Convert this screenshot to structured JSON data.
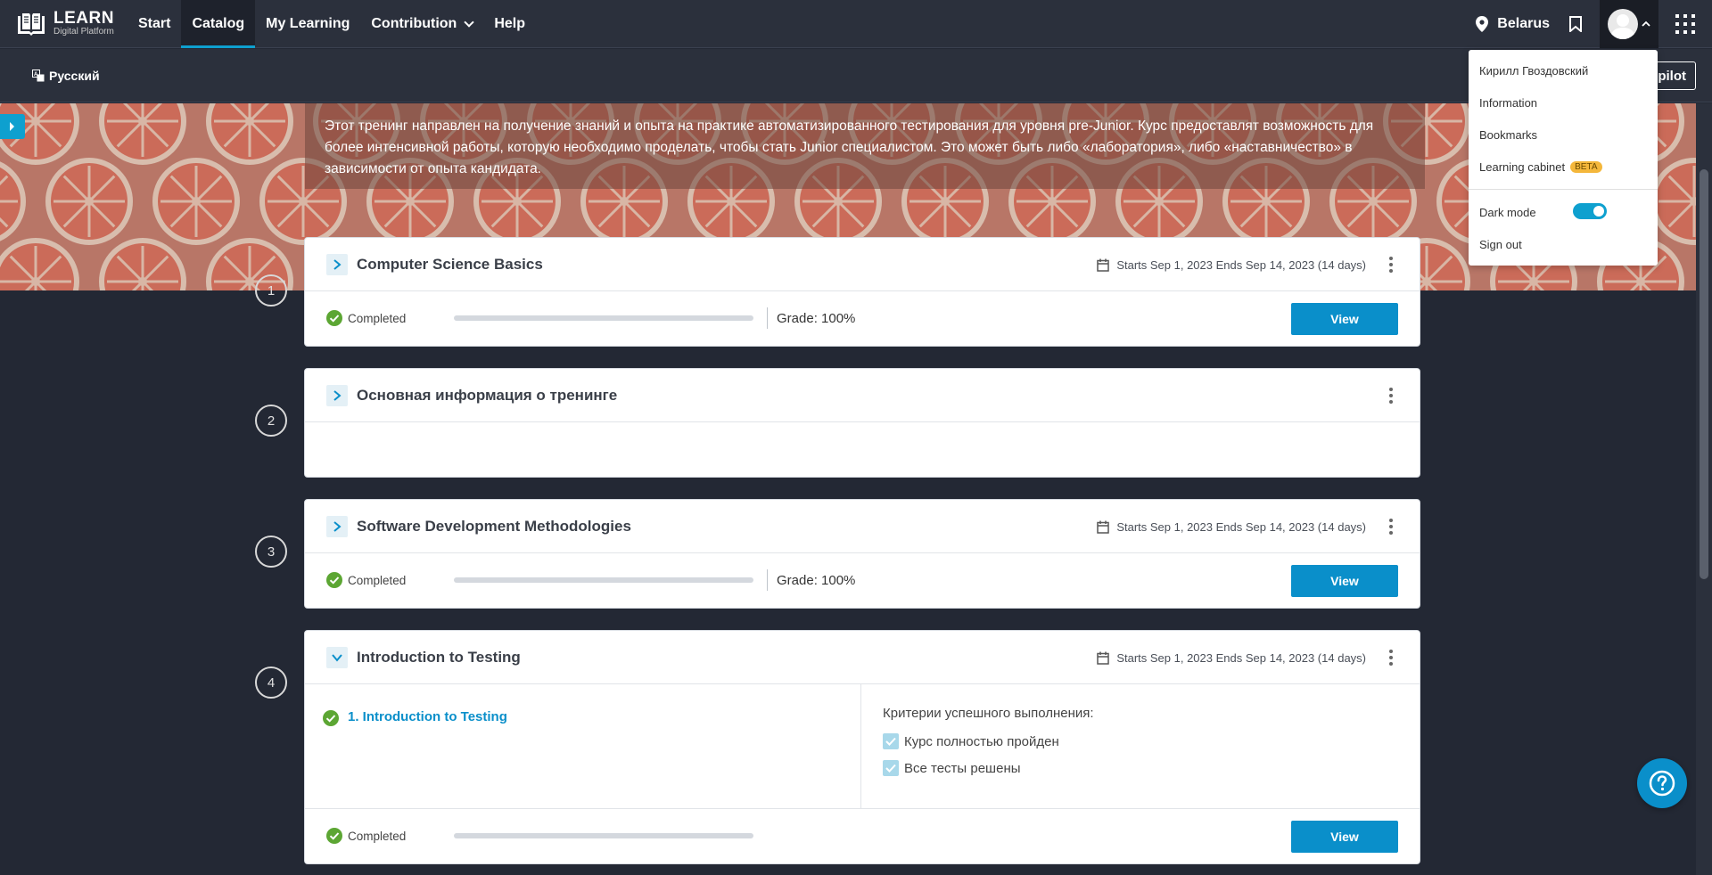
{
  "header": {
    "logo_title": "LEARN",
    "logo_subtitle": "Digital Platform",
    "nav": [
      "Start",
      "Catalog",
      "My Learning",
      "Contribution",
      "Help"
    ],
    "active_nav": "Catalog",
    "location": "Belarus"
  },
  "subbar": {
    "language": "Русский",
    "copilot_label": "pilot"
  },
  "banner": {
    "description": "Этот тренинг направлен на получение знаний и опыта на практике автоматизированного тестирования для уровня pre-Junior. Курс предоставлят возможность для более интенсивной работы, которую необходимо проделать, чтобы стать Junior специалистом. Это может быть либо «лаборатория», либо «наставничество» в зависимости от опыта кандидата."
  },
  "modules": [
    {
      "number": "1",
      "title": "Computer Science Basics",
      "dates": "Starts Sep 1, 2023 Ends Sep 14, 2023 (14 days)",
      "status": "Completed",
      "grade": "Grade: 100%",
      "view_label": "View",
      "progress": 1.0
    },
    {
      "number": "2",
      "title": "Основная информация о тренинге"
    },
    {
      "number": "3",
      "title": "Software Development Methodologies",
      "dates": "Starts Sep 1, 2023 Ends Sep 14, 2023 (14 days)",
      "status": "Completed",
      "grade": "Grade: 100%",
      "view_label": "View",
      "progress": 1.0
    },
    {
      "number": "4",
      "title": "Introduction to Testing",
      "dates": "Starts Sep 1, 2023 Ends Sep 14, 2023 (14 days)",
      "lesson": "1. Introduction to Testing",
      "criteria_title": "Критерии успешного выполнения:",
      "criteria": [
        "Курс полностью пройден",
        "Все тесты решены"
      ],
      "status": "Completed",
      "view_label": "View",
      "progress": 1.0
    }
  ],
  "user_menu": {
    "name": "Кирилл Гвоздовский",
    "items": [
      "Information",
      "Bookmarks",
      "Learning cabinet"
    ],
    "beta_badge": "BETA",
    "dark_mode_label": "Dark mode",
    "dark_mode_on": true,
    "sign_out": "Sign out"
  },
  "colors": {
    "accent": "#0a8fca",
    "success": "#5ca633",
    "beta": "#f4b73b",
    "background": "#232834"
  }
}
